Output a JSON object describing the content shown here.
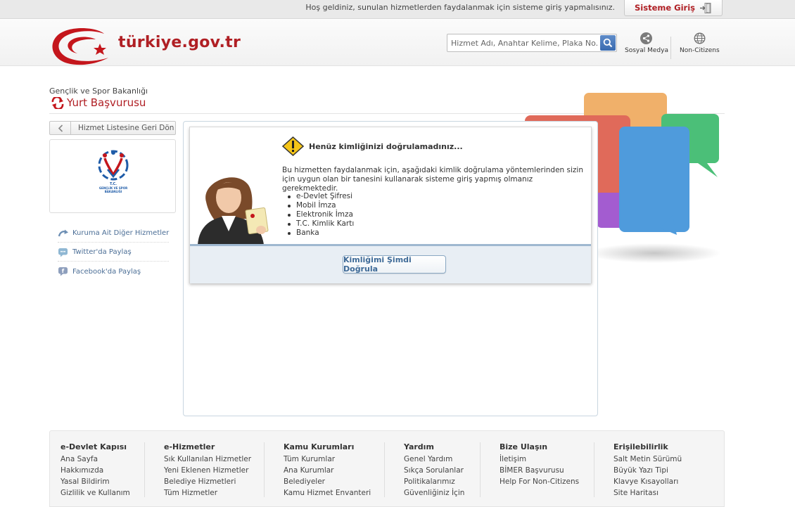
{
  "topbar": {
    "welcome_text": "Hoş geldiniz, sunulan hizmetlerden faydalanmak için sisteme giriş yapmalısınız.",
    "login_label": "Sisteme Giriş"
  },
  "header": {
    "logo_text": "türkiye.gov.tr",
    "search_placeholder": "Hizmet Adı, Anahtar Kelime, Plaka No...",
    "social_label": "Sosyal Medya",
    "noncitizens_label": "Non-Citizens"
  },
  "page": {
    "ministry": "Gençlik ve Spor Bakanlığı",
    "title": "Yurt Başvurusu"
  },
  "sidebar": {
    "back_label": "Hizmet Listesine Geri Dön",
    "logo_line1": "T.C.",
    "logo_line2": "GENÇLİK VE SPOR",
    "logo_line3": "BAKANLIĞI",
    "links": [
      {
        "label": "Kuruma Ait Diğer Hizmetler",
        "icon": "related-services-icon"
      },
      {
        "label": "Twitter'da Paylaş",
        "icon": "twitter-icon"
      },
      {
        "label": "Facebook'da Paylaş",
        "icon": "facebook-icon"
      }
    ]
  },
  "notice": {
    "heading": "Henüz kimliğinizi doğrulamadınız...",
    "text": "Bu hizmetten faydalanmak için, aşağıdaki kimlik doğrulama yöntemlerinden sizin için uygun olan bir tanesini kullanarak sisteme giriş yapmış olmanız gerekmektedir.",
    "methods": [
      "e-Devlet Şifresi",
      "Mobil İmza",
      "Elektronik İmza",
      "T.C. Kimlik Kartı",
      "Banka"
    ],
    "verify_label": "Kimliğimi Şimdi Doğrula"
  },
  "footer": {
    "columns": [
      {
        "title": "e-Devlet Kapısı",
        "links": [
          "Ana Sayfa",
          "Hakkımızda",
          "Yasal Bildirim",
          "Gizlilik ve Kullanım"
        ]
      },
      {
        "title": "e-Hizmetler",
        "links": [
          "Sık Kullanılan Hizmetler",
          "Yeni Eklenen Hizmetler",
          "Belediye Hizmetleri",
          "Tüm Hizmetler"
        ]
      },
      {
        "title": "Kamu Kurumları",
        "links": [
          "Tüm Kurumlar",
          "Ana Kurumlar",
          "Belediyeler",
          "Kamu Hizmet Envanteri"
        ]
      },
      {
        "title": "Yardım",
        "links": [
          "Genel Yardım",
          "Sıkça Sorulanlar",
          "Politikalarımız",
          "Güvenliğiniz İçin"
        ]
      },
      {
        "title": "Bize Ulaşın",
        "links": [
          "İletişim",
          "BİMER Başvurusu",
          "Help For Non-Citizens"
        ]
      },
      {
        "title": "Erişilebilirlik",
        "links": [
          "Salt Metin Sürümü",
          "Büyük Yazı Tipi",
          "Klavye Kısayolları",
          "Site Haritası"
        ]
      }
    ]
  },
  "colors": {
    "brand_red": "#b01f24",
    "link_blue": "#4b6e96",
    "button_blue": "#3e6a97"
  }
}
